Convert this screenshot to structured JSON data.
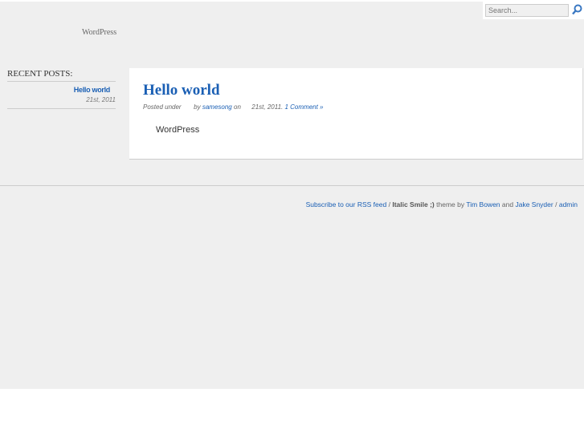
{
  "search": {
    "placeholder": "Search..."
  },
  "header": {
    "blog_name": "WordPress"
  },
  "sidebar": {
    "title": "RECENT POSTS:",
    "posts": [
      {
        "title": "Hello world",
        "date": "21st, 2011"
      }
    ]
  },
  "post": {
    "title": "Hello world",
    "posted_under": "Posted under",
    "by": "by",
    "author": "samesong",
    "on": "on",
    "date": "21st, 2011.",
    "comments": "1 Comment »",
    "content": "WordPress"
  },
  "footer": {
    "rss": "Subscribe to our RSS feed",
    "sep1": "/",
    "theme_name": "Italic Smile ;)",
    "theme_by": "theme by",
    "author1": "Tim Bowen",
    "and": "and",
    "author2": "Jake Snyder",
    "sep2": "/",
    "admin": "admin"
  },
  "colors": {
    "link": "#1a5fb4",
    "background": "#efefef"
  }
}
